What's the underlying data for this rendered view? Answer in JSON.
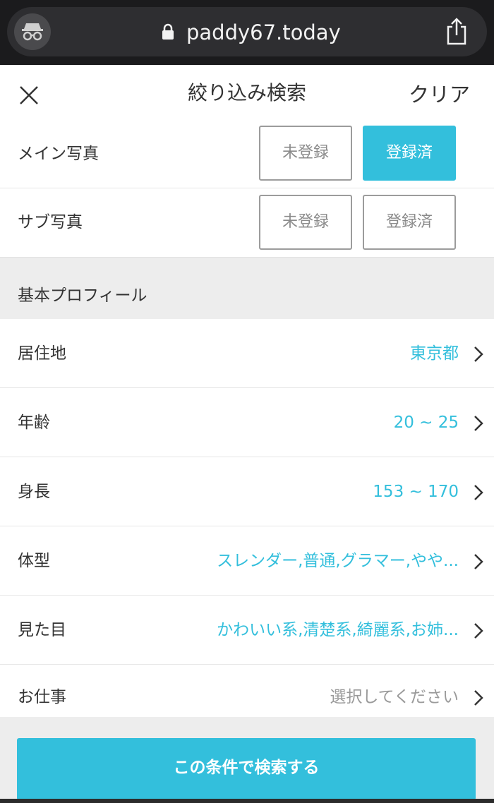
{
  "browser": {
    "url": "paddy67.today",
    "icons": [
      "incognito-icon",
      "lock-icon",
      "share-icon"
    ]
  },
  "header": {
    "title": "絞り込み検索",
    "clear_label": "クリア",
    "close_icon": "close-icon"
  },
  "photos": {
    "main": {
      "label": "メイン写真",
      "options": [
        "未登録",
        "登録済"
      ],
      "selected": "登録済"
    },
    "sub": {
      "label": "サブ写真",
      "options": [
        "未登録",
        "登録済"
      ],
      "selected": null
    }
  },
  "section": {
    "title": "基本プロフィール"
  },
  "rows": [
    {
      "label": "居住地",
      "value": "東京都"
    },
    {
      "label": "年齢",
      "value": "20 ~ 25"
    },
    {
      "label": "身長",
      "value": "153 ~ 170"
    },
    {
      "label": "体型",
      "value": "スレンダー,普通,グラマー,やや..."
    },
    {
      "label": "見た目",
      "value": "かわいい系,清楚系,綺麗系,お姉..."
    },
    {
      "label": "お仕事",
      "value": "選択してください"
    }
  ],
  "search_button": {
    "label": "この条件で検索する"
  },
  "colors": {
    "accent": "#33bfdc",
    "placeholder": "#9a9a9a"
  }
}
